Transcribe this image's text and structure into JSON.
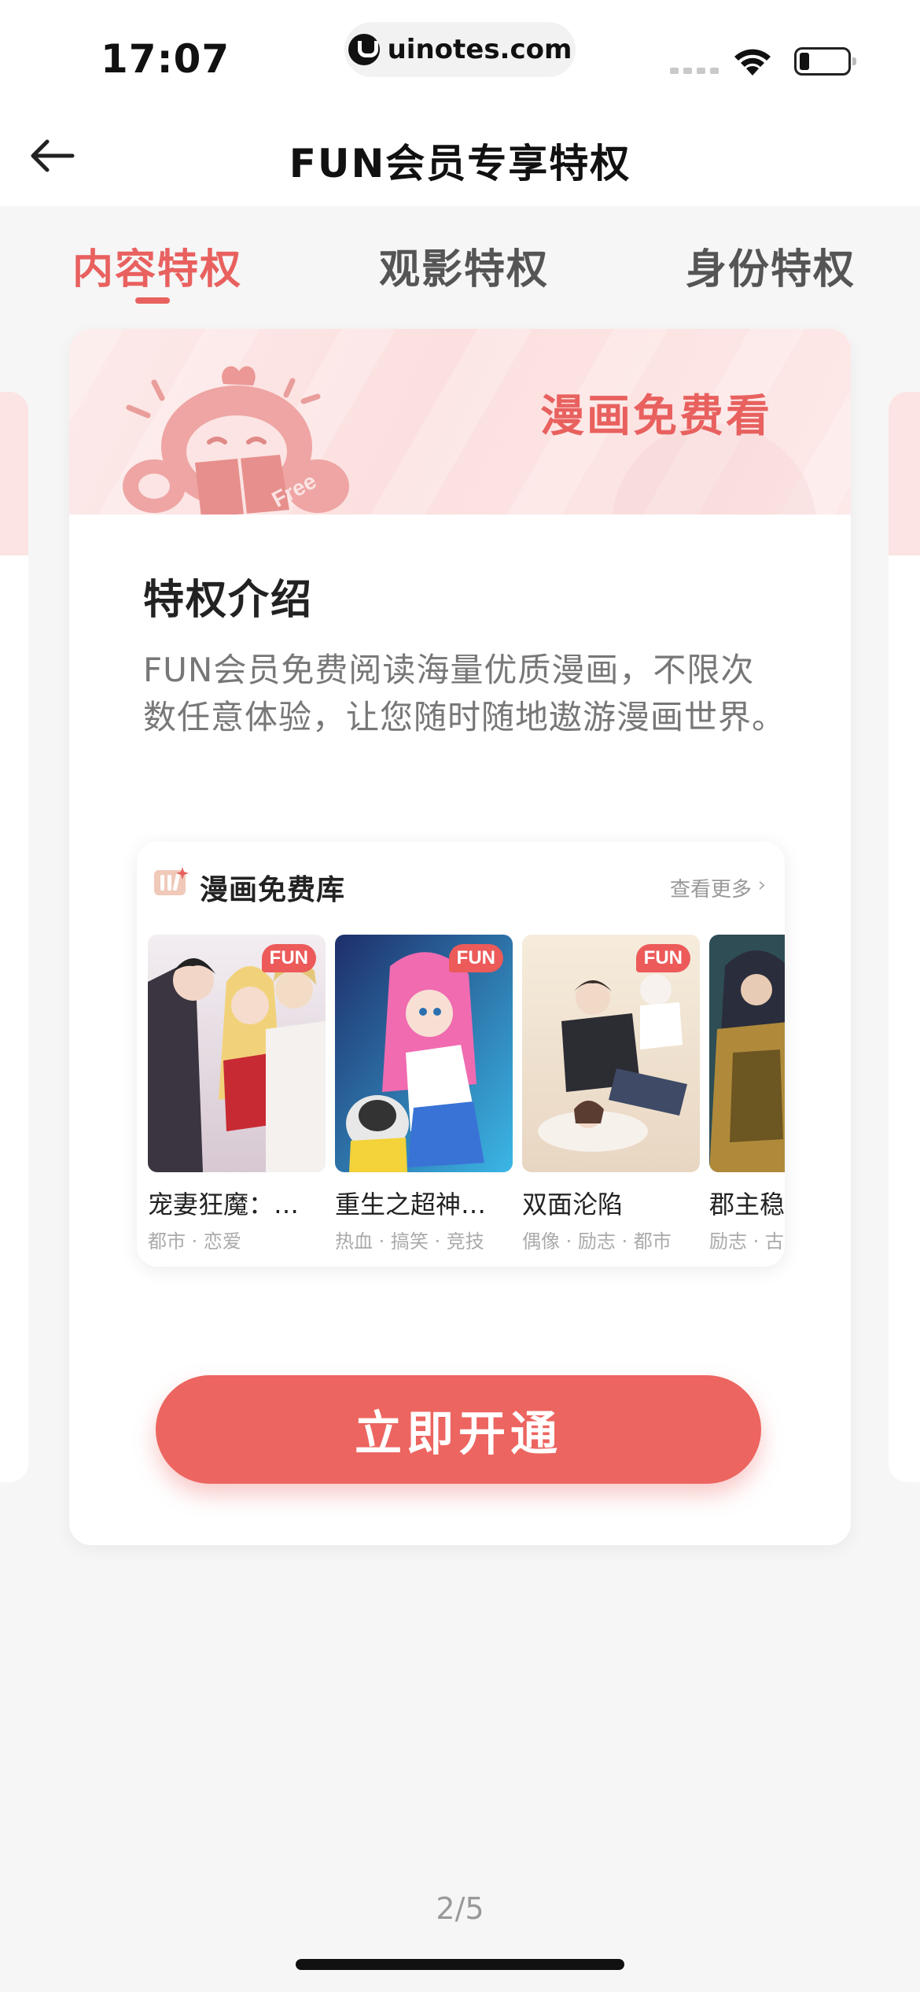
{
  "status_bar": {
    "time": "17:07",
    "url": "uinotes.com",
    "icons": [
      "site-logo-icon",
      "signal-icon",
      "wifi-icon",
      "battery-icon"
    ]
  },
  "nav": {
    "back_icon": "arrow-left-icon",
    "title": "FUN会员专享特权"
  },
  "tabs": [
    {
      "label": "内容特权",
      "active": true
    },
    {
      "label": "观影特权",
      "active": false
    },
    {
      "label": "身份特权",
      "active": false
    }
  ],
  "card": {
    "banner_title": "漫画免费看",
    "section_title": "特权介绍",
    "section_desc": "FUN会员免费阅读海量优质漫画，不限次数任意体验，让您随时随地遨游漫画世界。",
    "library": {
      "title": "漫画免费库",
      "more_label": "查看更多",
      "comics": [
        {
          "title": "宠妻狂魔：…",
          "tags": "都市 · 恋爱",
          "badge": "FUN"
        },
        {
          "title": "重生之超神…",
          "tags": "热血 · 搞笑 · 竞技",
          "badge": "FUN"
        },
        {
          "title": "双面沦陷",
          "tags": "偶像 · 励志 · 都市",
          "badge": "FUN"
        },
        {
          "title": "郡主稳",
          "tags": "励志 · 古",
          "badge": ""
        }
      ]
    },
    "cta_label": "立即开通"
  },
  "pager": "2/5",
  "colors": {
    "accent": "#e8615f",
    "cta": "#ec6560",
    "banner": "#fbe4e3",
    "badge": "#ec5a5a"
  }
}
